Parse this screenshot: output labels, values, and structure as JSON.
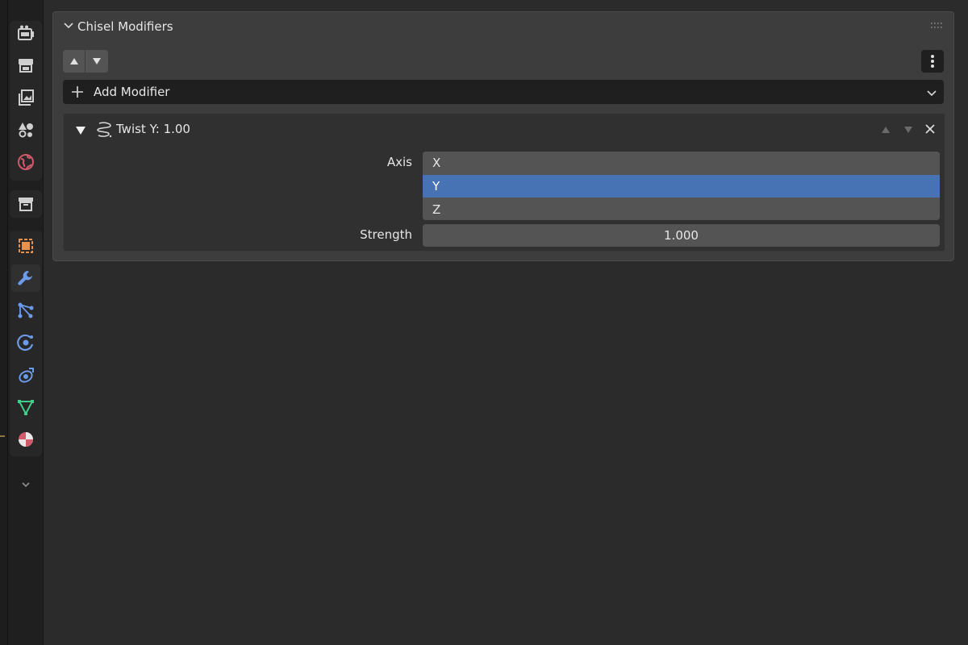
{
  "panel": {
    "title": "Chisel Modifiers"
  },
  "toolbar": {
    "add_modifier_label": "Add Modifier"
  },
  "modifier": {
    "name": "Twist Y: 1.00",
    "axis_label": "Axis",
    "axis_options": [
      "X",
      "Y",
      "Z"
    ],
    "axis_selected": "Y",
    "strength_label": "Strength",
    "strength_value": "1.000"
  },
  "property_tabs": [
    {
      "icon": "render-icon",
      "color": "#cfcfcf"
    },
    {
      "icon": "output-icon",
      "color": "#cfcfcf"
    },
    {
      "icon": "view-layer-icon",
      "color": "#cfcfcf"
    },
    {
      "icon": "scene-icon",
      "color": "#cfcfcf"
    },
    {
      "icon": "world-icon",
      "color": "#d0596a"
    },
    {
      "icon": "collection-icon",
      "color": "#cfcfcf"
    },
    {
      "icon": "object-icon",
      "color": "#e8914a"
    },
    {
      "icon": "modifier-wrench-icon",
      "color": "#6b9bea",
      "active": true
    },
    {
      "icon": "particles-icon",
      "color": "#6b9bea"
    },
    {
      "icon": "physics-icon",
      "color": "#6b9bea"
    },
    {
      "icon": "constraints-icon",
      "color": "#6b9bea"
    },
    {
      "icon": "data-mesh-icon",
      "color": "#3fcf8a"
    },
    {
      "icon": "material-icon",
      "color": "#d0596a"
    }
  ],
  "colors": {
    "accent_selected": "#4772b3",
    "panel_bg": "#3d3d3d",
    "field_bg": "#545454"
  }
}
